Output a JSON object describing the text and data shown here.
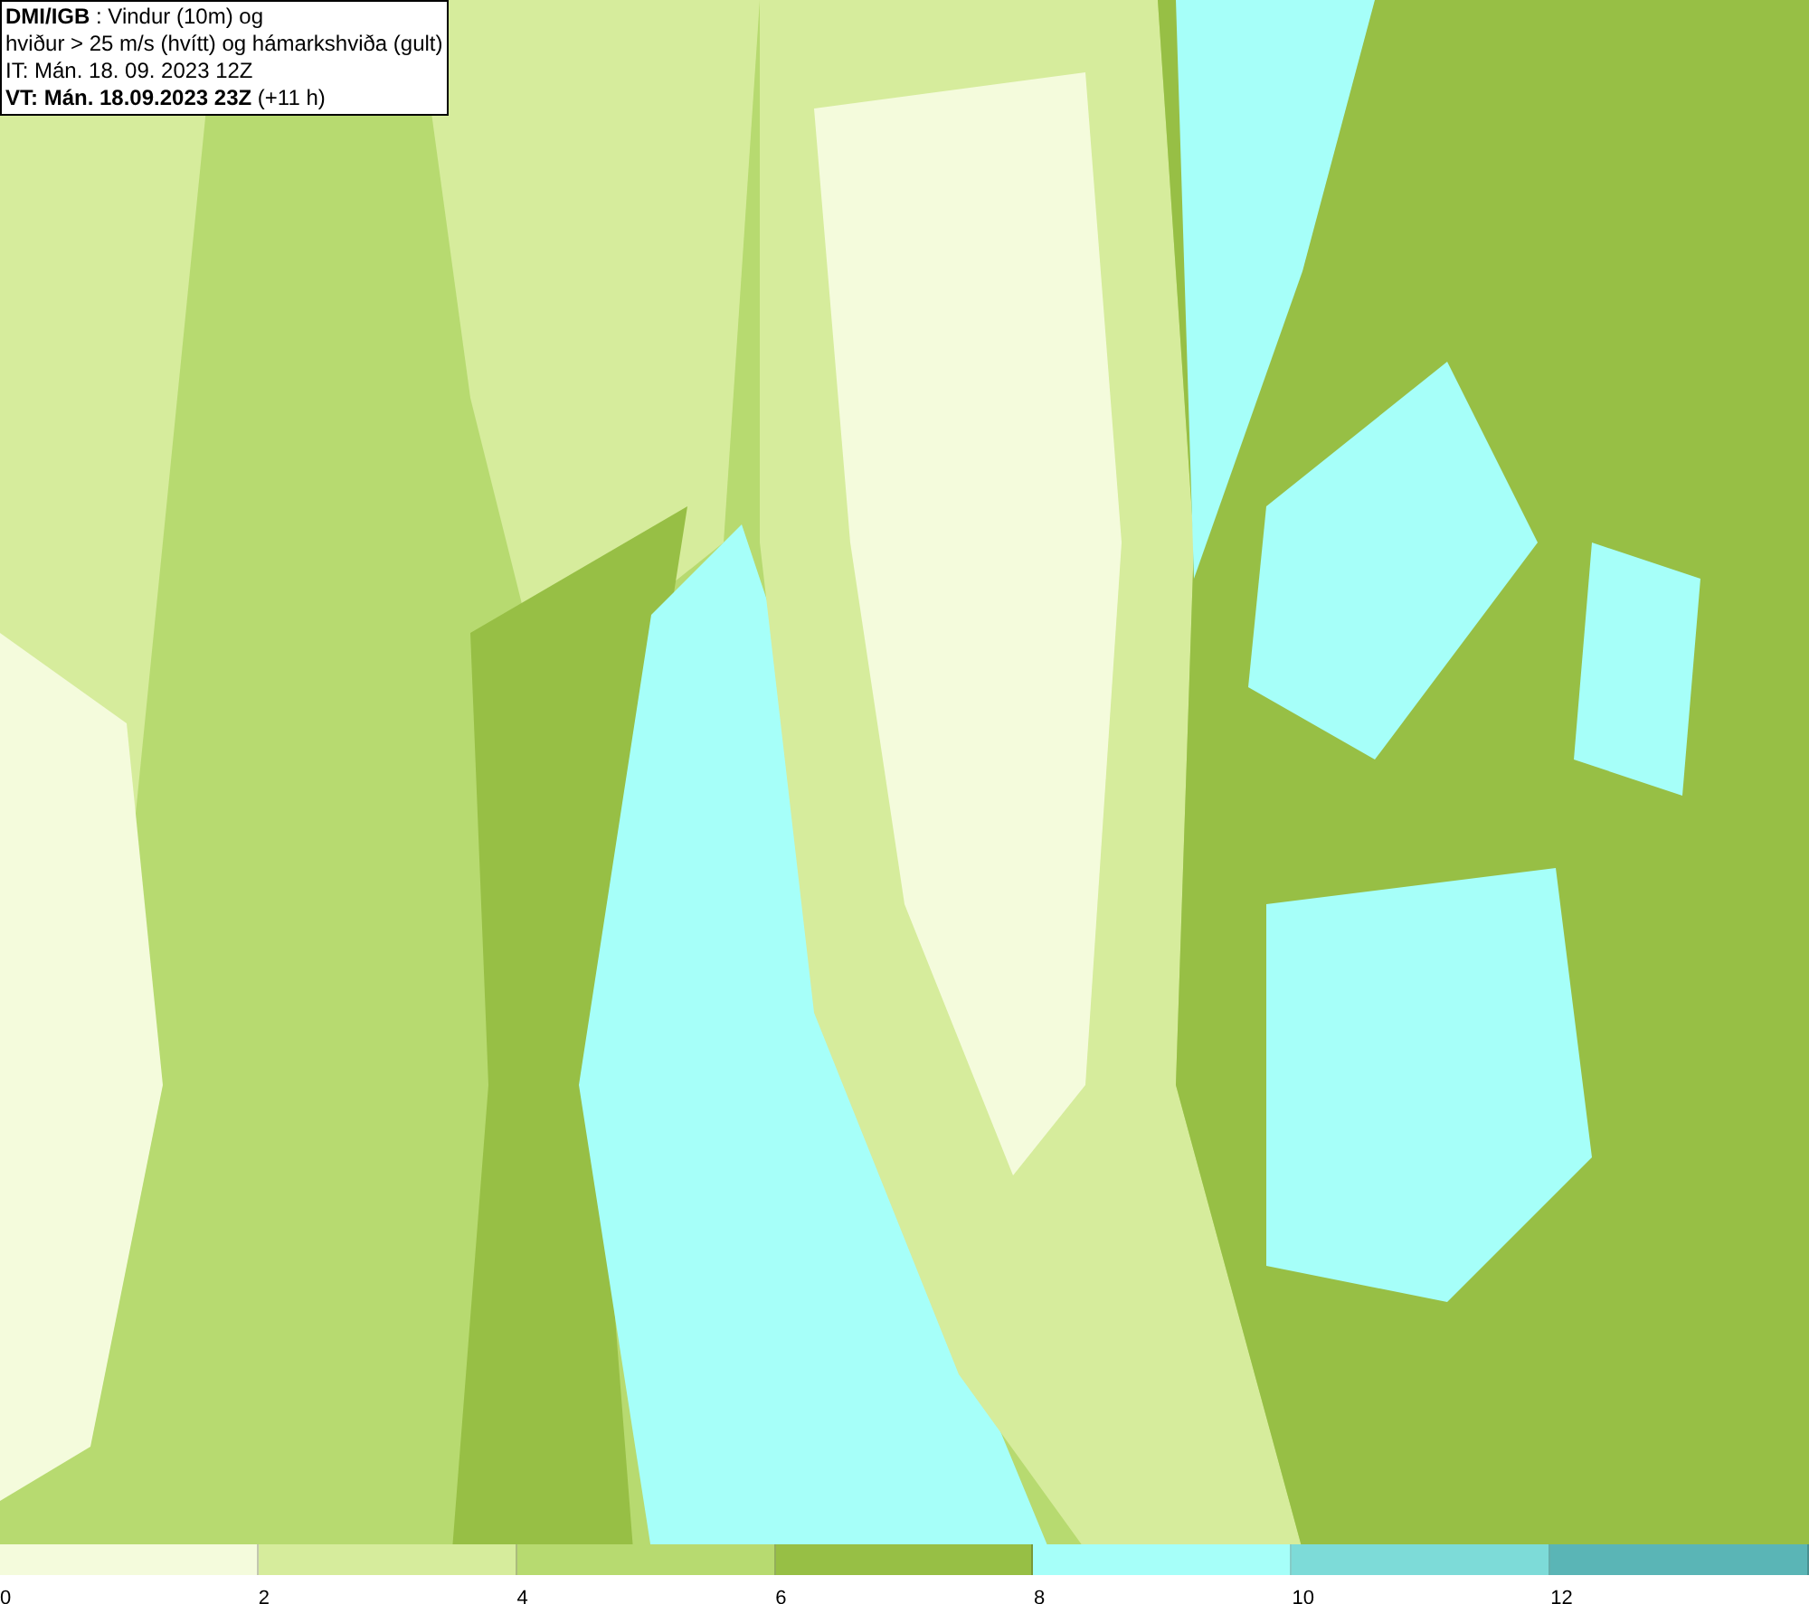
{
  "title_box": {
    "lines": [
      "**DMI/IGB** : Vindur (10m) og",
      "hviður > 25 m/s (hvítt) og hámarkshviða (gult)",
      "IT: Mán. 18. 09. 2023 12Z",
      "**VT: Mán. 18.09.2023 23Z** (+11 h)"
    ]
  },
  "legend": [
    {
      "label": "0",
      "color": "#f4fbdc"
    },
    {
      "label": "2",
      "color": "#d6ec9c"
    },
    {
      "label": "4",
      "color": "#b7da70"
    },
    {
      "label": "6",
      "color": "#97bf45"
    },
    {
      "label": "8",
      "color": "#a6fff9"
    },
    {
      "label": "10",
      "color": "#7ddbd8"
    },
    {
      "label": "12",
      "color": "#5ab5b6"
    }
  ]
}
